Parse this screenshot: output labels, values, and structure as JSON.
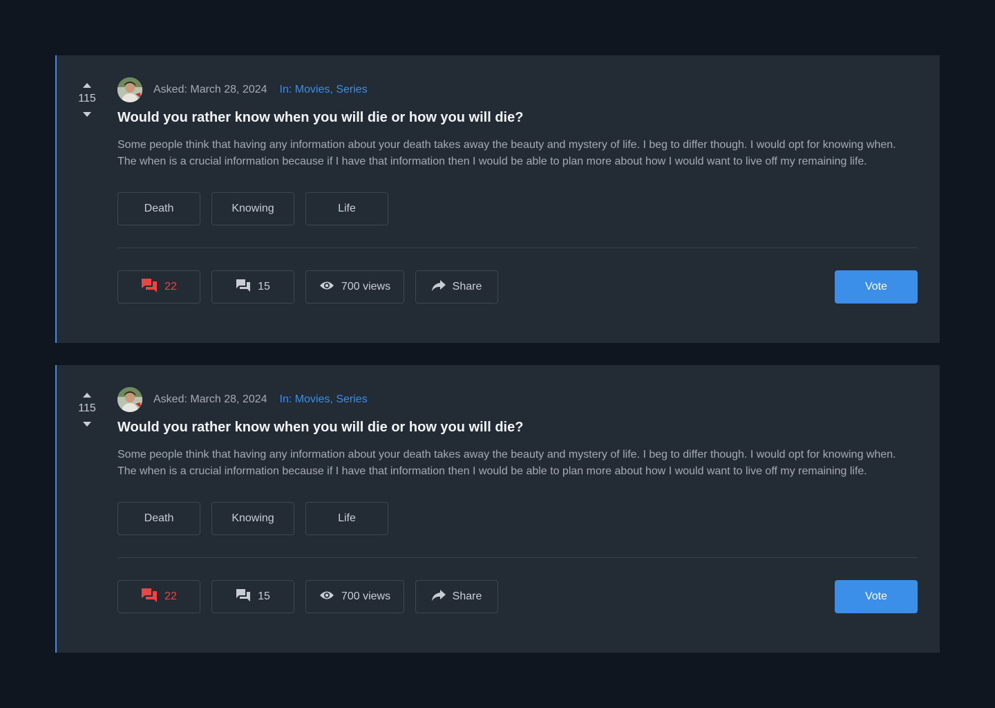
{
  "posts": [
    {
      "score": "115",
      "asked": "Asked: March 28, 2024",
      "in_prefix": "In: ",
      "categories": "Movies, Series",
      "title": "Would you rather know when you will die or how you will die?",
      "body": "Some people think that having any information about your death takes away the beauty and mystery of life. I beg to differ though. I would opt for knowing when. The when is a crucial information because if I have that information then I would be able to plan more about how I would want to live off my remaining life.",
      "tags": [
        "Death",
        "Knowing",
        "Life"
      ],
      "answers_count": "22",
      "comments_count": "15",
      "views": "700 views",
      "share_label": "Share",
      "vote_label": "Vote"
    },
    {
      "score": "115",
      "asked": "Asked: March 28, 2024",
      "in_prefix": "In: ",
      "categories": "Movies, Series",
      "title": "Would you rather know when you will die or how you will die?",
      "body": "Some people think that having any information about your death takes away the beauty and mystery of life. I beg to differ though. I would opt for knowing when. The when is a crucial information because if I have that information then I would be able to plan more about how I would want to live off my remaining life.",
      "tags": [
        "Death",
        "Knowing",
        "Life"
      ],
      "answers_count": "22",
      "comments_count": "15",
      "views": "700 views",
      "share_label": "Share",
      "vote_label": "Vote"
    }
  ],
  "colors": {
    "accent": "#3b8fe8",
    "answers_red": "#ef4444",
    "card_bg": "#232b35",
    "page_bg": "#0f1620"
  },
  "icons": {
    "upvote": "triangle-up-icon",
    "downvote": "triangle-down-icon",
    "answers": "chat-bubbles-icon",
    "comments": "chat-bubbles-icon",
    "views": "eye-icon",
    "share": "share-arrow-icon",
    "avatar": "user-avatar"
  }
}
